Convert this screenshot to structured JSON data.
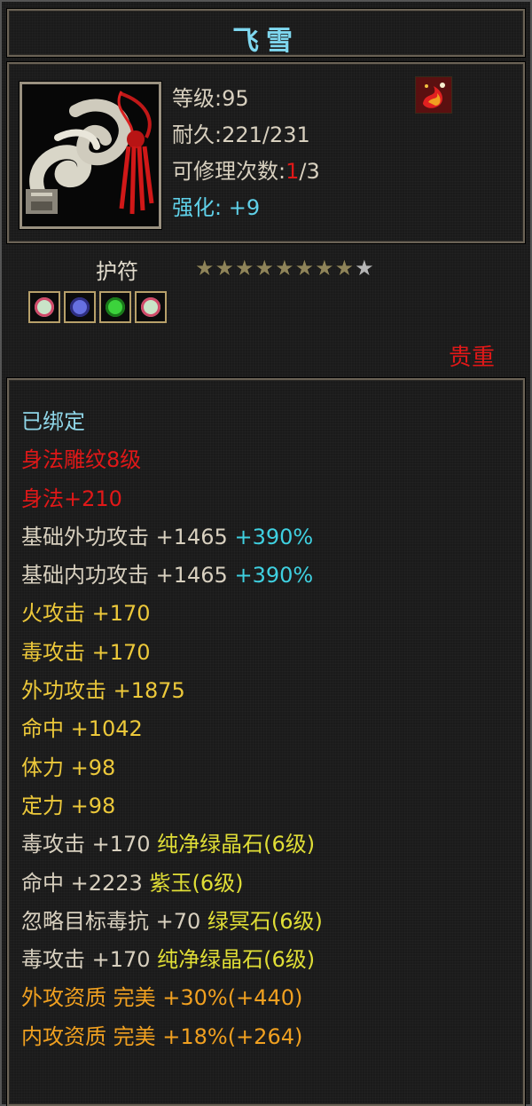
{
  "item": {
    "name": "飞雪",
    "level": "等级:95",
    "durability": {
      "label": "耐久:",
      "value": "221/231"
    },
    "repair": {
      "label": "可修理次数:",
      "used": "1",
      "rest": "/3"
    },
    "enhance": "强化: +9",
    "type": "护符",
    "rarity": "贵重",
    "stars": {
      "filled": 8,
      "total": 9
    },
    "gems": [
      {
        "icon": "white-green-gem-icon",
        "color": "#c9e4c8",
        "ring": "#d14a6a"
      },
      {
        "icon": "purple-gem-icon",
        "color": "#6670e0",
        "ring": "#2e2e80"
      },
      {
        "icon": "green-gem-icon",
        "color": "#3cd33c",
        "ring": "#1a7a1a"
      },
      {
        "icon": "white-green-gem-icon",
        "color": "#c9e4c8",
        "ring": "#d14a6a"
      }
    ]
  },
  "attributes": [
    {
      "text": "已绑定",
      "color": "c-cyan"
    },
    {
      "text": "身法雕纹8级",
      "color": "c-red"
    },
    {
      "text": "身法+210",
      "color": "c-red"
    },
    {
      "text": "基础外功攻击 +1465",
      "extra": " +390%",
      "color": "c-white"
    },
    {
      "text": "基础内功攻击 +1465",
      "extra": " +390%",
      "color": "c-white"
    },
    {
      "text": "火攻击 +170",
      "color": "c-yellow"
    },
    {
      "text": "毒攻击 +170",
      "color": "c-yellow"
    },
    {
      "text": "外功攻击 +1875",
      "color": "c-yellow"
    },
    {
      "text": "命中 +1042",
      "color": "c-yellow"
    },
    {
      "text": "体力 +98",
      "color": "c-yellow"
    },
    {
      "text": "定力 +98",
      "color": "c-yellow"
    },
    {
      "text": "毒攻击 +170",
      "gem": " 纯净绿晶石(6级)",
      "color": "c-white"
    },
    {
      "text": "命中 +2223",
      "gem": " 紫玉(6级)",
      "color": "c-white"
    },
    {
      "text": "忽略目标毒抗 +70",
      "gem": " 绿冥石(6级)",
      "color": "c-white"
    },
    {
      "text": "毒攻击 +170",
      "gem": " 纯净绿晶石(6级)",
      "color": "c-white"
    },
    {
      "text": "外攻资质  完美 +30%(+440)",
      "color": "c-orange"
    },
    {
      "text": "内攻资质  完美 +18%(+264)",
      "color": "c-orange"
    }
  ],
  "colors": {
    "title": "#7fd8f0",
    "rarity": "#e01818",
    "enhance": "#5fd0e8"
  }
}
